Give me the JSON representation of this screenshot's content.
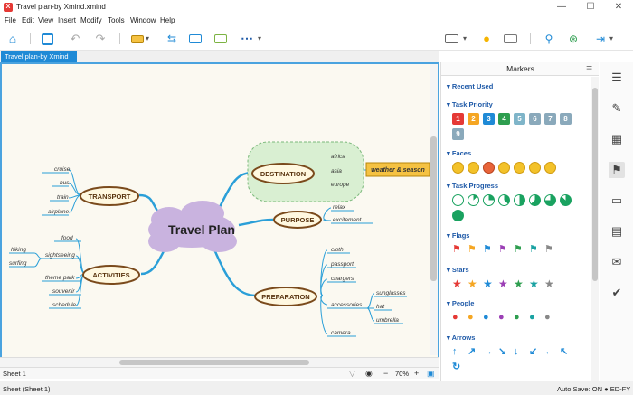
{
  "window": {
    "title": "Travel plan-by Xmind.xmind",
    "logo": "X"
  },
  "menu": [
    "File",
    "Edit",
    "View",
    "Insert",
    "Modify",
    "Tools",
    "Window",
    "Help"
  ],
  "tab": {
    "label": "Travel plan-by Xmind",
    "close": "×"
  },
  "map": {
    "central": "Travel Plan",
    "topics": {
      "destination": "DESTINATION",
      "transport": "TRANSPORT",
      "purpose": "PURPOSE",
      "activities": "ACTIVITIES",
      "preparation": "PREPARATION"
    },
    "destination_children": [
      "africa",
      "asia",
      "europe"
    ],
    "callout": "weather & season",
    "transport_children": [
      "cruise",
      "bus",
      "train",
      "airplane"
    ],
    "purpose_children": [
      "relax",
      "excitement"
    ],
    "activities_children": [
      "food",
      "sightseeing",
      "theme park",
      "souvenir",
      "schedule"
    ],
    "sightseeing_children": [
      "hiking",
      "surfing"
    ],
    "preparation_children": [
      "cloth",
      "passport",
      "chargers",
      "accessories",
      "camera"
    ],
    "accessories_children": [
      "sunglasses",
      "hat",
      "umbrella"
    ]
  },
  "sheet": {
    "tab": "Sheet 1",
    "zoom": "70%",
    "zoom_minus": "−",
    "zoom_plus": "+"
  },
  "status": {
    "left": "Sheet (Sheet 1)",
    "right": "Auto Save: ON  ● ED-FY"
  },
  "panel": {
    "title": "Markers",
    "sections": {
      "recent": "Recent Used",
      "priority": "Task Priority",
      "faces": "Faces",
      "progress": "Task Progress",
      "flags": "Flags",
      "stars": "Stars",
      "people": "People",
      "arrows": "Arrows"
    },
    "priority_labels": [
      "1",
      "2",
      "3",
      "4",
      "5",
      "6",
      "7",
      "8",
      "9"
    ]
  },
  "colors": {
    "accent": "#1f8ad6",
    "topic_border": "#7a4a1c",
    "branch": "#2a9fd8",
    "central_fill": "#c9b3df"
  }
}
